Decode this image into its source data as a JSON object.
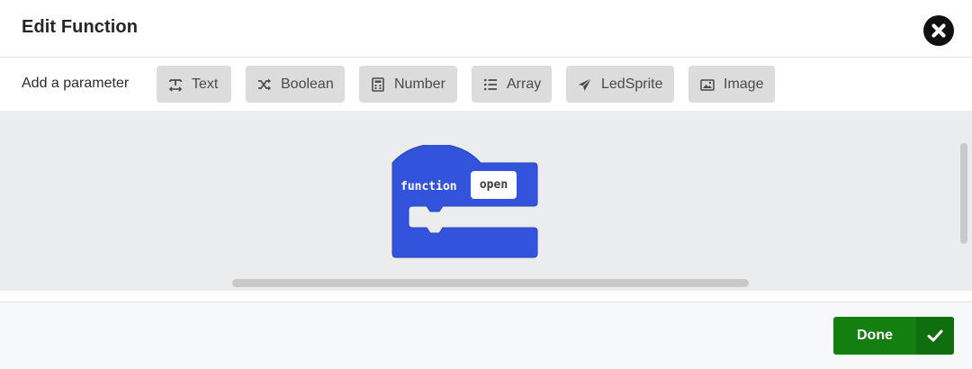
{
  "dialog": {
    "title": "Edit Function",
    "close_icon": "close-circle-icon"
  },
  "params": {
    "label": "Add a parameter",
    "buttons": [
      {
        "label": "Text",
        "icon": "text-icon"
      },
      {
        "label": "Boolean",
        "icon": "shuffle-icon"
      },
      {
        "label": "Number",
        "icon": "calculator-icon"
      },
      {
        "label": "Array",
        "icon": "list-icon"
      },
      {
        "label": "LedSprite",
        "icon": "paper-plane-icon"
      },
      {
        "label": "Image",
        "icon": "image-icon"
      }
    ]
  },
  "workspace": {
    "block": {
      "keyword": "function",
      "name": "open",
      "color": "#3453dc"
    }
  },
  "footer": {
    "done_label": "Done",
    "done_icon": "checkmark-icon",
    "done_color": "#137f11"
  }
}
